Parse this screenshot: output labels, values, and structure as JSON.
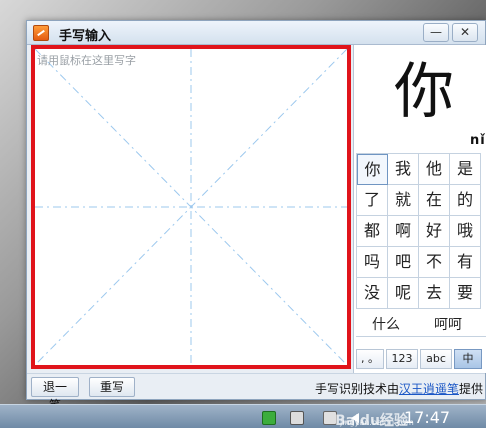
{
  "window": {
    "title": "手写输入",
    "min_glyph": "—",
    "close_glyph": "✕"
  },
  "pad": {
    "placeholder": "请用鼠标在这里写字"
  },
  "recognition": {
    "big_char": "你",
    "pinyin": "nǐ",
    "candidates": [
      "你",
      "我",
      "他",
      "是",
      "了",
      "就",
      "在",
      "的",
      "都",
      "啊",
      "好",
      "哦",
      "吗",
      "吧",
      "不",
      "有",
      "没",
      "呢",
      "去",
      "要"
    ],
    "phrases": [
      "什么",
      "呵呵"
    ],
    "modes": [
      ", 。",
      "123",
      "abc",
      "中"
    ]
  },
  "bottom": {
    "undo_label": "退一笔",
    "rewrite_label": "重写",
    "credit_prefix": "手写识别技术由",
    "credit_link": "汉王",
    "credit_link2": "逍遥笔",
    "credit_suffix": "提供"
  },
  "taskbar": {
    "clock": "17:47"
  },
  "watermark": {
    "brand": "Baidu经验",
    "url": "jingyan.baidu.com"
  },
  "colors": {
    "pad_border": "#e0141b",
    "guide_line": "#9cc8ee",
    "link": "#1a56c5"
  }
}
